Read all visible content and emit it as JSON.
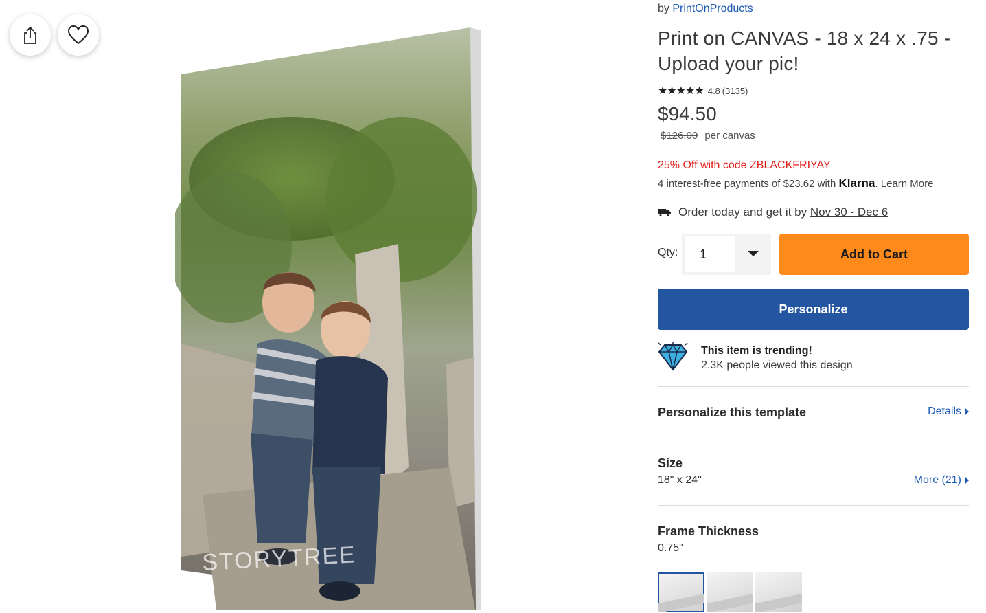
{
  "actions": {
    "share_icon": "share-icon",
    "favorite_icon": "heart-icon"
  },
  "product": {
    "by_prefix": "by",
    "brand": "PrintOnProducts",
    "title": "Print on CANVAS - 18 x 24 x .75 - Upload your pic!",
    "stars": "★★★★★",
    "rating": "4.8",
    "review_count": "(3135)",
    "price": "$94.50",
    "original_price": "$126.00",
    "price_unit": "per canvas",
    "promo": "25% Off with code ZBLACKFRIYAY",
    "klarna_prefix": "4 interest-free payments of $23.62 with",
    "klarna_brand": "Klarna",
    "klarna_period": ".",
    "klarna_learn_more": "Learn More",
    "delivery_prefix": "Order today and get it by",
    "delivery_dates": "Nov 30 - Dec 6",
    "image_watermark": "STORYTREE"
  },
  "purchase": {
    "qty_label": "Qty:",
    "qty_value": "1",
    "add_to_cart": "Add to Cart",
    "personalize": "Personalize"
  },
  "trending": {
    "title": "This item is trending!",
    "subtitle": "2.3K people viewed this design"
  },
  "sections": {
    "template_title": "Personalize this template",
    "template_link": "Details",
    "size_title": "Size",
    "size_value": "18\" x 24\"",
    "size_link": "More (21)",
    "frame_title": "Frame Thickness",
    "frame_value": "0.75\""
  },
  "colors": {
    "brand_blue": "#2355a0",
    "cart_orange": "#ff8a1c",
    "promo_red": "#e0201b",
    "link_blue": "#1f5bb5"
  }
}
